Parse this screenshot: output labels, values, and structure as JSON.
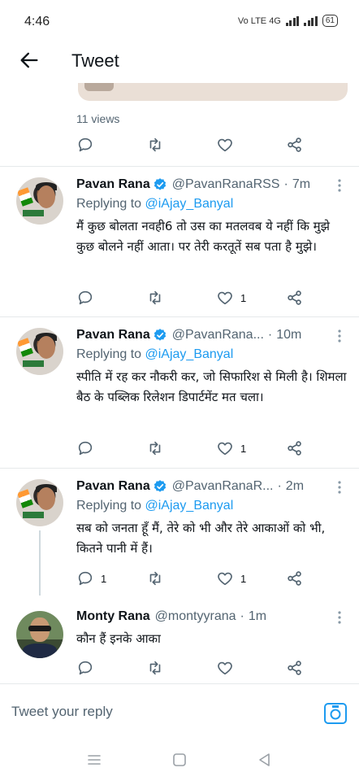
{
  "status_bar": {
    "time": "4:46",
    "network": "Vo LTE 4G",
    "battery": "61"
  },
  "app_bar": {
    "title": "Tweet",
    "back_icon": "back-arrow-icon"
  },
  "main_tweet": {
    "views": "11 views",
    "action_icons": [
      "reply-icon",
      "retweet-icon",
      "like-icon",
      "share-icon"
    ]
  },
  "tweets": [
    {
      "name": "Pavan Rana",
      "handle": "@PavanRanaRSS",
      "dot": "·",
      "time": "7m",
      "replying_prefix": "Replying to",
      "replying_to": "@iAjay_Banyal",
      "text": "मैं कुछ बोलता नवही6 तो उस का मतलवब ये नहीं कि मुझे कुछ बोलने नहीं आता। पर तेरी करतूतें सब पता है मुझे।",
      "reply_count": "",
      "like_count": "1"
    },
    {
      "name": "Pavan Rana",
      "handle": "@PavanRana...",
      "dot": "·",
      "time": "10m",
      "replying_prefix": "Replying to",
      "replying_to": "@iAjay_Banyal",
      "text": "स्पीति में रह कर नौकरी कर, जो सिफारिश से मिली है। शिमला बैठ के पब्लिक रिलेशन डिपार्टमेंट मत चला।",
      "reply_count": "",
      "like_count": "1"
    },
    {
      "name": "Pavan Rana",
      "handle": "@PavanRanaR...",
      "dot": "·",
      "time": "2m",
      "replying_prefix": "Replying to",
      "replying_to": "@iAjay_Banyal",
      "text": "सब को जनता हूँ मैं, तेरे को भी और तेरे आकाओं को भी, कितने पानी में हैं।",
      "reply_count": "1",
      "like_count": "1"
    },
    {
      "name": "Monty Rana",
      "handle": "@montyyrana",
      "dot": "·",
      "time": "1m",
      "text": "कौन हैं इनके आका",
      "reply_count": "",
      "like_count": ""
    }
  ],
  "reply_bar": {
    "placeholder": "Tweet your reply",
    "camera_icon": "camera-icon"
  },
  "nav_bar": {
    "icons": [
      "menu-icon",
      "home-square-icon",
      "back-triangle-icon"
    ]
  },
  "colors": {
    "accent": "#1d9bf0",
    "secondary_text": "#536471",
    "divider": "#e6e9eb"
  }
}
